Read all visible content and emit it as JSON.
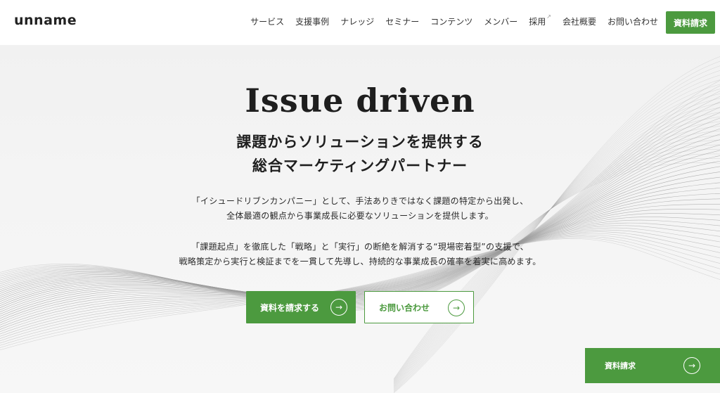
{
  "header": {
    "logo": "unname",
    "nav": [
      {
        "label": "サービス"
      },
      {
        "label": "支援事例"
      },
      {
        "label": "ナレッジ"
      },
      {
        "label": "セミナー"
      },
      {
        "label": "コンテンツ"
      },
      {
        "label": "メンバー"
      },
      {
        "label": "採用",
        "icon": "external-link-icon"
      },
      {
        "label": "会社概要"
      },
      {
        "label": "お問い合わせ"
      }
    ],
    "cta_label": "資料請求"
  },
  "hero": {
    "title": "Issue driven",
    "subtitle_line1": "課題からソリューションを提供する",
    "subtitle_line2": "総合マーケティングパートナー",
    "desc_line1": "「イシュードリブンカンパニー」として、手法ありきではなく課題の特定から出発し、",
    "desc_line2": "全体最適の観点から事業成長に必要なソリューションを提供します。",
    "desc_line3": "「課題起点」を徹底した「戦略」と「実行」の断絶を解消する“現場密着型”の支援で、",
    "desc_line4": "戦略策定から実行と検証までを一貫して先導し、持続的な事業成長の確率を着実に高めます。",
    "primary_button": "資料を請求する",
    "secondary_button": "お問い合わせ",
    "arrow_icon": "arrow-right-icon"
  },
  "floating_cta": {
    "label": "資料請求"
  },
  "colors": {
    "brand_green": "#4c9a3f",
    "hero_bg": "#f3f3f3",
    "wave_lines": "#9a9a9a"
  }
}
